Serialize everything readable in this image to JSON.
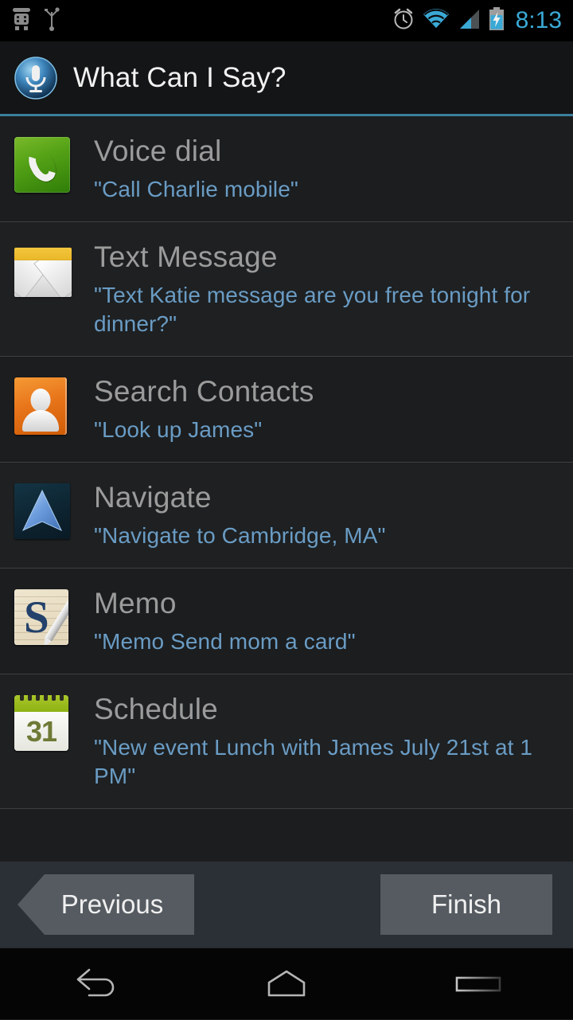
{
  "statusbar": {
    "time": "8:13",
    "icons": [
      "android-debug-icon",
      "usb-icon",
      "alarm-clock-icon",
      "wifi-icon",
      "cell-signal-icon",
      "battery-charging-icon"
    ]
  },
  "titlebar": {
    "app_icon": "microphone-icon",
    "title": "What Can I Say?",
    "accent_color": "#3b7f9e"
  },
  "list": {
    "items": [
      {
        "icon": "phone-icon",
        "title": "Voice dial",
        "example": "\"Call Charlie mobile\""
      },
      {
        "icon": "envelope-icon",
        "title": "Text Message",
        "example": "\"Text Katie message are you free tonight for dinner?\""
      },
      {
        "icon": "contact-icon",
        "title": "Search Contacts",
        "example": "\"Look up James\""
      },
      {
        "icon": "navigate-icon",
        "title": "Navigate",
        "example": "\"Navigate to Cambridge, MA\""
      },
      {
        "icon": "memo-icon",
        "title": "Memo",
        "example": "\"Memo Send mom a card\""
      },
      {
        "icon": "calendar-icon",
        "title": "Schedule",
        "example": "\"New event Lunch with James July 21st at 1 PM\"",
        "day": "31"
      }
    ]
  },
  "footer": {
    "previous_label": "Previous",
    "finish_label": "Finish"
  },
  "navbar": {
    "back": "back-icon",
    "home": "home-icon",
    "recents": "recent-apps-icon"
  }
}
